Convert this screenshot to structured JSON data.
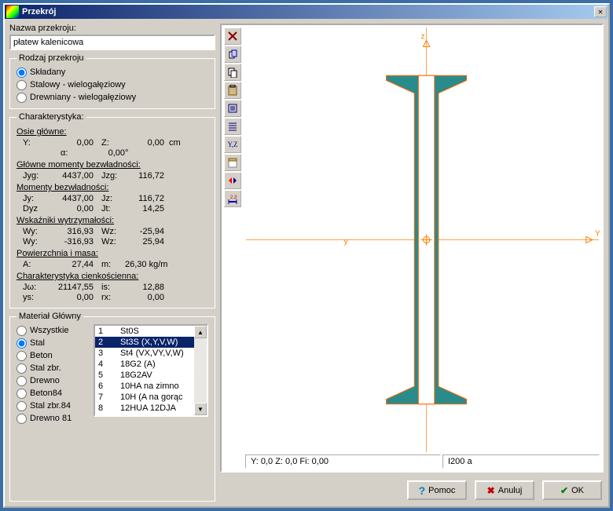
{
  "window": {
    "title": "Przekrój"
  },
  "name_label": "Nazwa przekroju:",
  "name_value": "płatew kalenicowa",
  "type_group": {
    "legend": "Rodzaj przekroju",
    "options": [
      "Składany",
      "Stalowy - wielogałęziowy",
      "Drewniany - wielogałęziowy"
    ],
    "selected": 0
  },
  "char": {
    "legend": "Charakterystyka:",
    "axes_heading": "Osie główne:",
    "axes": {
      "Y": "0,00",
      "Z": "0,00",
      "unit": "cm",
      "alpha_label": "α:",
      "alpha": "0,00",
      "alpha_unit": "°"
    },
    "moments_main_heading": "Główne momenty bezwładności:",
    "moments_main": {
      "Jyg": "4437,00",
      "Jzg": "116,72"
    },
    "moments_heading": "Momenty bezwładności:",
    "moments": {
      "Jy": "4437,00",
      "Jz": "116,72",
      "Dyz": "0,00",
      "Jt": "14,25"
    },
    "strength_heading": "Wskaźniki wytrzymałości:",
    "strength": {
      "Wy1": "316,93",
      "Wz1": "-25,94",
      "Wy2": "-316,93",
      "Wz2": "25,94"
    },
    "area_heading": "Powierzchnia i masa:",
    "area": {
      "A": "27,44",
      "m": "26,30 kg/m"
    },
    "thin_heading": "Charakterystyka cienkościenna:",
    "thin": {
      "Jw": "21147,55",
      "is": "12,88",
      "ys": "0,00",
      "rx": "0,00"
    }
  },
  "material": {
    "legend": "Materiał Główny",
    "radios": [
      "Wszystkie",
      "Stal",
      "Beton",
      "Stal zbr.",
      "Drewno",
      "Beton84",
      "Stal zbr.84",
      "Drewno 81"
    ],
    "radio_selected": 1,
    "items": [
      {
        "n": "1",
        "name": "St0S"
      },
      {
        "n": "2",
        "name": "St3S (X,Y,V,W)"
      },
      {
        "n": "3",
        "name": "St4 (VX,VY,V,W)"
      },
      {
        "n": "4",
        "name": "18G2 (A)"
      },
      {
        "n": "5",
        "name": "18G2AV"
      },
      {
        "n": "6",
        "name": "10HA  na zimno"
      },
      {
        "n": "7",
        "name": "10H (A na gorąc"
      },
      {
        "n": "8",
        "name": "12HUA 12DJA"
      }
    ],
    "selected_index": 1
  },
  "status": {
    "coords": "Y: 0,0 Z: 0,0 Fi: 0,00",
    "profile": "I200 a"
  },
  "buttons": {
    "help": "Pomoc",
    "cancel": "Anuluj",
    "ok": "OK"
  },
  "toolbar_icons": [
    "deselect",
    "insert",
    "copy",
    "paste",
    "props",
    "list",
    "yz",
    "sheet",
    "mirror",
    "dims"
  ],
  "axis_labels": {
    "y": "y",
    "Y": "Y",
    "z": "z"
  }
}
